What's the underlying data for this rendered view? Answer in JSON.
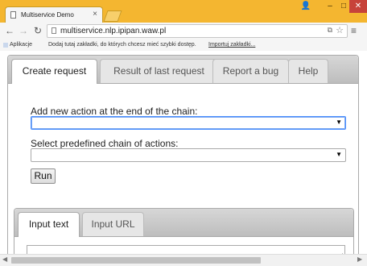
{
  "browser": {
    "tab_title": "Multiservice Demo",
    "tab_close": "×",
    "window_buttons": {
      "user": "👤",
      "minimize": "–",
      "maximize": "□",
      "close": "✕"
    },
    "nav": {
      "back": "←",
      "forward": "→",
      "reload": "↻",
      "menu": "≡"
    },
    "url": "multiservice.nlp.ipipan.waw.pl",
    "omnibox_icons": {
      "translate": "⧉",
      "star": "☆"
    },
    "bookmarks": {
      "apps_label": "Aplikacje",
      "message": "Dodaj tutaj zakładki, do których chcesz mieć szybki dostęp.",
      "import_link": "Importuj zakładki..."
    }
  },
  "page": {
    "main_tabs": [
      {
        "label": "Create request",
        "active": true
      },
      {
        "label": "Result of last request",
        "active": false
      },
      {
        "label": "Report a bug",
        "active": false
      },
      {
        "label": "Help",
        "active": false
      }
    ],
    "form": {
      "add_action_label": "Add new action at the end of the chain:",
      "add_action_value": "",
      "predefined_label": "Select predefined chain of actions:",
      "predefined_value": "",
      "dropdown_arrow": "▼",
      "run_button": "Run"
    },
    "input_tabs": [
      {
        "label": "Input text",
        "active": true
      },
      {
        "label": "Input URL",
        "active": false
      }
    ],
    "scrollbar": {
      "left_arrow": "◀",
      "right_arrow": "▶"
    },
    "resize_grip": "◢"
  }
}
